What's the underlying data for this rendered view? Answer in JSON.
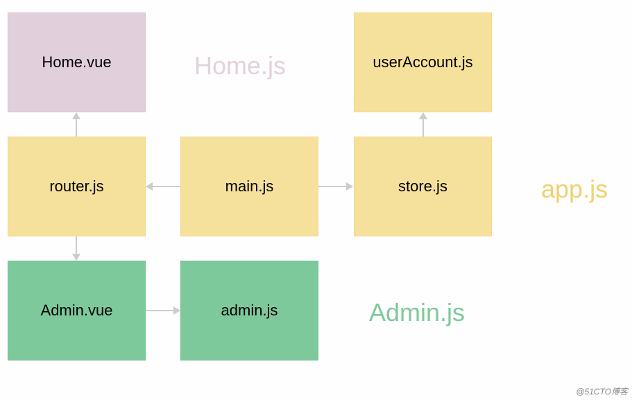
{
  "boxes": {
    "home_vue": "Home.vue",
    "user_account": "userAccount.js",
    "router": "router.js",
    "main": "main.js",
    "store": "store.js",
    "admin_vue": "Admin.vue",
    "admin_js": "admin.js"
  },
  "labels": {
    "home": "Home.js",
    "app": "app.js",
    "admin": "Admin.js"
  },
  "colors": {
    "mauve": "#e2cfdc",
    "yellow": "#f6e19c",
    "green": "#7ec99b"
  },
  "watermark": "@51CTO博客",
  "edges": [
    {
      "from": "router.js",
      "to": "Home.vue",
      "dir": "up"
    },
    {
      "from": "main.js",
      "to": "router.js",
      "dir": "left"
    },
    {
      "from": "main.js",
      "to": "store.js",
      "dir": "right"
    },
    {
      "from": "store.js",
      "to": "userAccount.js",
      "dir": "up"
    },
    {
      "from": "router.js",
      "to": "Admin.vue",
      "dir": "down"
    },
    {
      "from": "Admin.vue",
      "to": "admin.js",
      "dir": "right"
    }
  ]
}
